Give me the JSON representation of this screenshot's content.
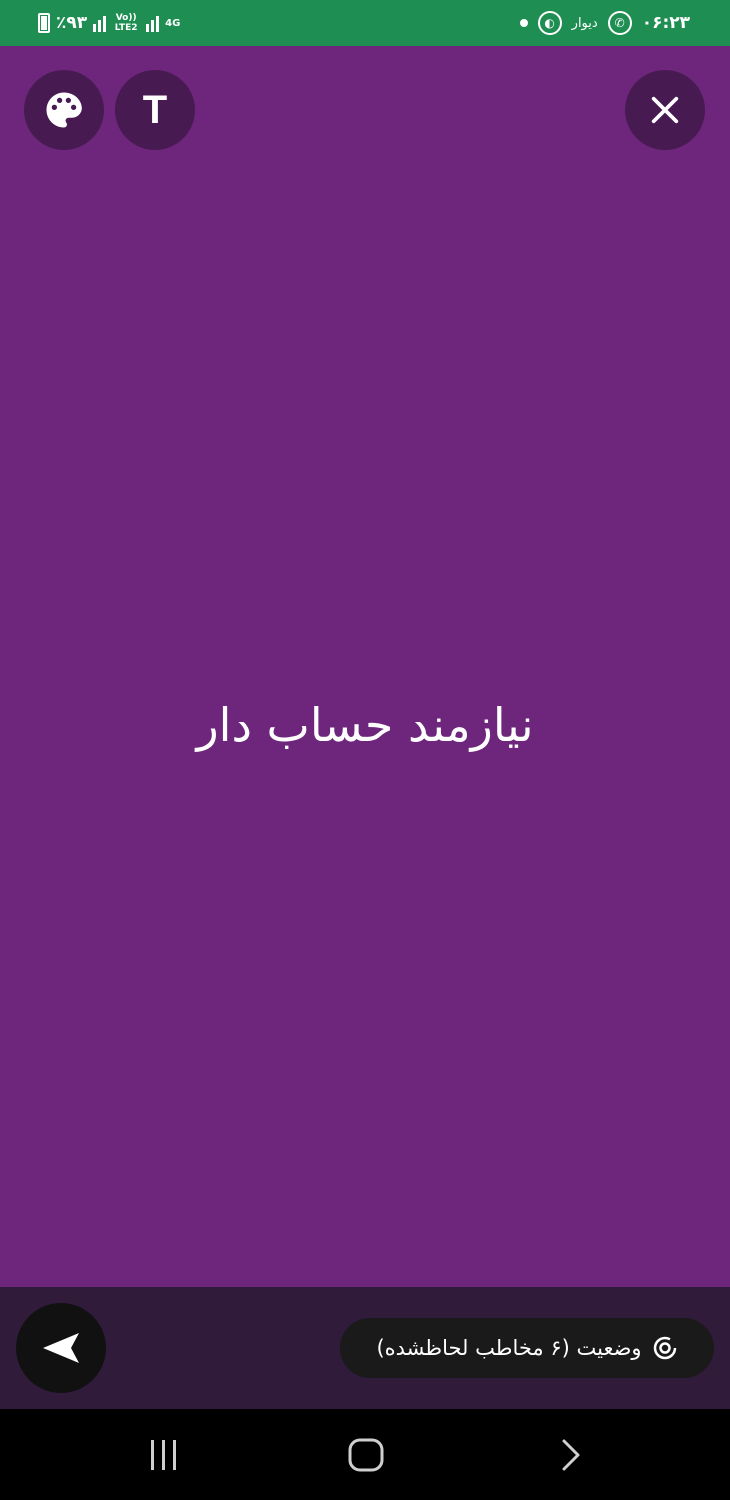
{
  "status_bar": {
    "battery": "٪۹۳",
    "network_volte": "Vo)) LTE2",
    "network_type": "4G",
    "app_name": "دیوار",
    "time": "۰۶:۲۳"
  },
  "toolbar": {
    "text_button_label": "T"
  },
  "main": {
    "text": "نیازمند حساب دار"
  },
  "bottom": {
    "status_label": "وضعیت (۶ مخاطب لحاظشده)"
  },
  "colors": {
    "background": "#6d267b",
    "status_bar": "#1f8e52",
    "button": "#481a52",
    "bottom_bar": "#301b3b"
  },
  "icons": [
    "palette-icon",
    "close-icon",
    "send-icon",
    "status-ring-icon",
    "recents-icon",
    "home-icon",
    "back-icon"
  ]
}
